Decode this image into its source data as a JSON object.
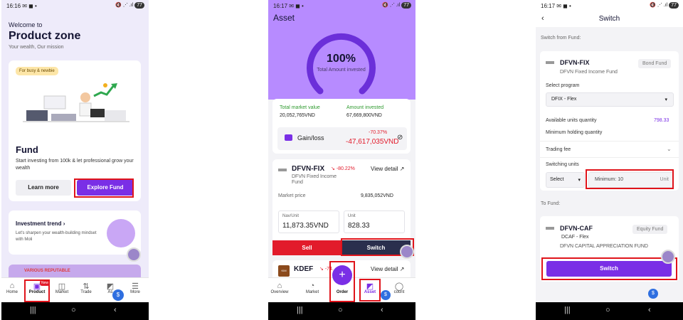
{
  "screen1": {
    "time": "16:16",
    "battery": "77",
    "welcome": "Welcome to",
    "title": "Product zone",
    "mission": "Your wealth, Our mission",
    "chip": "For busy & newbie",
    "fund_title": "Fund",
    "fund_desc": "Start investing from 100k & let professional grow your wealth",
    "learn_more": "Learn more",
    "explore_fund": "Explore Fund",
    "trend_title": "Investment trend",
    "trend_desc": "Let's sharpen your wealth-building mindset with Moli",
    "promo": "VARIOUS REPUTABLE",
    "product_badge": "New",
    "tabs": [
      "Home",
      "Product",
      "Market",
      "Trade",
      "As",
      "More"
    ]
  },
  "screen2": {
    "time": "16:17",
    "battery": "77",
    "title": "Asset",
    "percent": "100%",
    "percent_label": "Total Amount invested",
    "total_market_label": "Total market value",
    "total_market_value": "20,052,765VND",
    "amount_invested_label": "Amount invested",
    "amount_invested_value": "67,669,800VND",
    "gain_loss_label": "Gain/loss",
    "gain_loss_pct": "-70.37%",
    "gain_loss_value": "-47,617,035VND",
    "fund1_code": "DFVN-FIX",
    "fund1_change": "-80.22%",
    "fund1_name": "DFVN Fixed Income Fund",
    "view_detail": "View detail ↗",
    "market_price_label": "Market price",
    "market_price_value": "9,835,052VND",
    "nav_label": "Nav/Unit",
    "nav_value": "11,873.35VND",
    "unit_label": "Unit",
    "unit_value": "828.33",
    "sell": "Sell",
    "switch": "Switch",
    "fund2_code": "KDEF",
    "fund2_change": "-74.",
    "fund2_logo": "KIM",
    "order": "Order",
    "tabs": [
      "Overview",
      "Market",
      "Asset",
      "count"
    ]
  },
  "screen3": {
    "time": "16:17",
    "battery": "77",
    "title": "Switch",
    "switch_from": "Switch from Fund:",
    "from_code": "DFVN-FIX",
    "from_name": "DFVN Fixed Income Fund",
    "from_tag": "Bond Fund",
    "select_program": "Select program",
    "program_value": "DFIX - Flex",
    "available_label": "Available units quantity",
    "available_value": "798.33",
    "min_holding_label": "Minimum holding quantity",
    "trading_fee_label": "Trading fee",
    "switching_units_label": "Switching units",
    "select": "Select",
    "minimum_placeholder": "Minimum: 10",
    "unit": "Unit",
    "to_fund": "To Fund:",
    "to_code": "DFVN-CAF",
    "to_program": "DCAF - Flex",
    "to_name": "DFVN CAPITAL APPRECIATION FUND",
    "to_tag": "Equity Fund",
    "switch_button": "Switch"
  },
  "colors": {
    "accent": "#7a2fe6",
    "header_purple": "#b78bff",
    "sell_red": "#e21b2b",
    "dark_navy": "#2a2f4d",
    "highlight_red": "#e0141b",
    "gain_green": "#2f9a2f"
  }
}
